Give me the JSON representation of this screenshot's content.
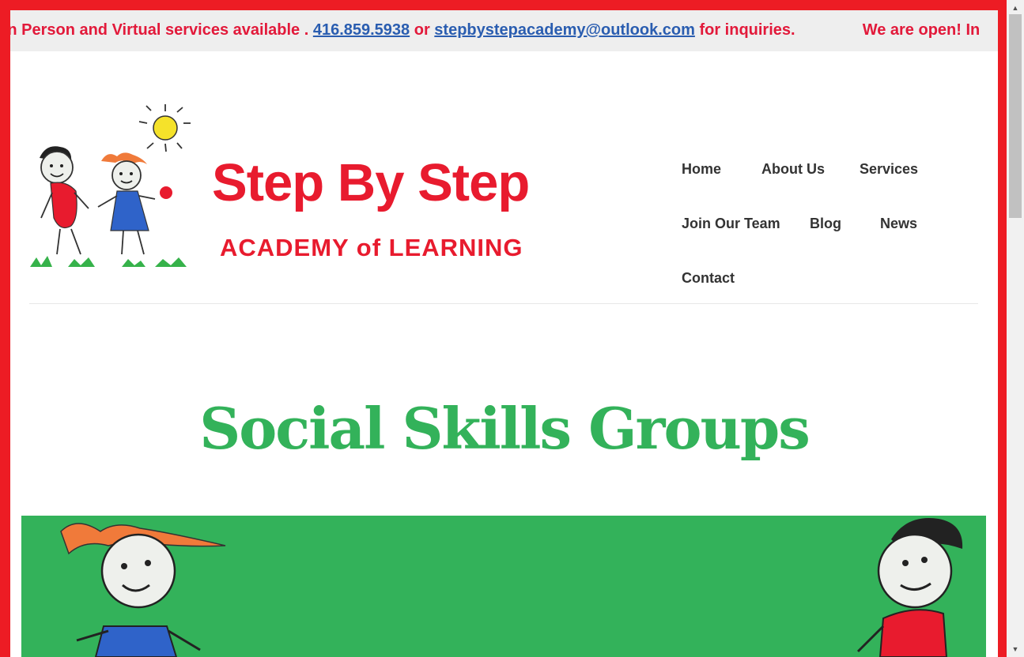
{
  "ticker": {
    "text_start": "pen! In Person and Virtual services available .",
    "phone": "416.859.5938",
    "or_text": "or",
    "email": "stepbystepacademy@outlook.com",
    "text_end": "for inquiries.",
    "repeat_text": "We are open! In"
  },
  "logo": {
    "title": "Step By Step",
    "subtitle": "ACADEMY of LEARNING"
  },
  "nav": {
    "home": "Home",
    "about": "About Us",
    "services": "Services",
    "join": "Join Our Team",
    "blog": "Blog",
    "news": "News",
    "contact": "Contact"
  },
  "page": {
    "title": "Social Skills Groups"
  },
  "colors": {
    "frame": "#ed1c24",
    "ticker_text": "#e2193a",
    "link": "#2a5db0",
    "brand_red": "#e81b2e",
    "title_green": "#33b25a",
    "hero_green": "#33b25a"
  },
  "icons": {
    "scroll_up": "arrow-up-icon",
    "scroll_down": "arrow-down-icon"
  }
}
